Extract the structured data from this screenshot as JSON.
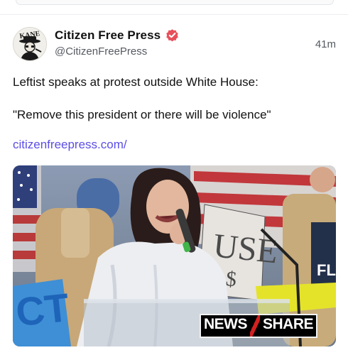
{
  "post": {
    "author": {
      "display_name": "Citizen Free Press",
      "handle": "@CitizenFreePress",
      "avatar_text": "KANE",
      "verified_icon": "verified-badge-icon",
      "verified_color": "#e8505b"
    },
    "timestamp": "41m",
    "body": [
      "Leftist speaks at protest outside White House:",
      "\"Remove this president or there will be violence\""
    ],
    "link_text": "citizenfreepress.com/",
    "link_color": "#5b4ee6",
    "media": {
      "type": "video-still",
      "watermark_left": "NEWS",
      "watermark_right": "SHARE",
      "background_signs": [
        "USE",
        "FL"
      ]
    }
  }
}
